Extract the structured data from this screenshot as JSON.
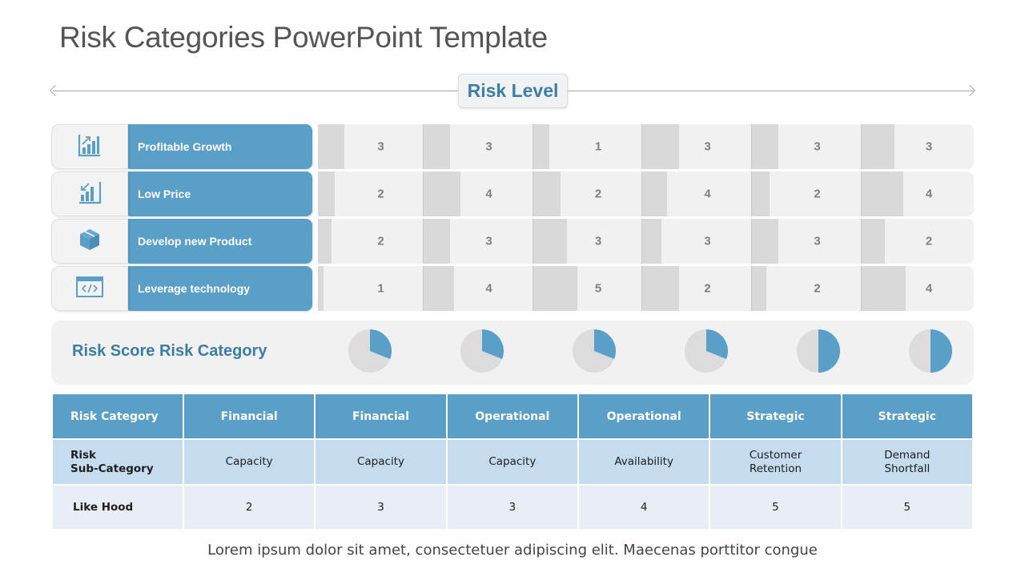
{
  "title": "Risk Categories PowerPoint Template",
  "risk_level_label": "Risk Level",
  "colors": {
    "accent": "#5a9fc8",
    "heading": "#3a7ea3",
    "bar": "#d9d9d9",
    "cell": "#f1f1f1"
  },
  "factors": [
    {
      "label": "Profitable Growth",
      "icon": "growth-chart-icon",
      "values": [
        3,
        3,
        1,
        3,
        3,
        3
      ],
      "bar_fill": [
        0.25,
        0.24,
        0.15,
        0.34,
        0.24,
        0.29
      ]
    },
    {
      "label": "Low Price",
      "icon": "declining-chart-icon",
      "values": [
        2,
        4,
        2,
        4,
        2,
        4
      ],
      "bar_fill": [
        0.16,
        0.34,
        0.25,
        0.23,
        0.16,
        0.37
      ]
    },
    {
      "label": "Develop new Product",
      "icon": "product-box-icon",
      "values": [
        2,
        3,
        3,
        3,
        3,
        2
      ],
      "bar_fill": [
        0.13,
        0.24,
        0.31,
        0.18,
        0.24,
        0.21
      ]
    },
    {
      "label": "Leverage technology",
      "icon": "code-window-icon",
      "values": [
        1,
        4,
        5,
        2,
        2,
        4
      ],
      "bar_fill": [
        0.05,
        0.28,
        0.41,
        0.34,
        0.13,
        0.39
      ]
    }
  ],
  "risk_score": {
    "title": "Risk Score Risk Category",
    "pie_fractions": [
      0.31,
      0.31,
      0.31,
      0.31,
      0.5,
      0.5
    ]
  },
  "table": {
    "row_labels": {
      "category": "Risk  Category",
      "sub_line1": "Risk",
      "sub_line2": "Sub-Category",
      "likelihood": "Like  Hood"
    },
    "columns": [
      {
        "category": "Financial",
        "sub": [
          "Capacity"
        ],
        "likelihood": "2"
      },
      {
        "category": "Financial",
        "sub": [
          "Capacity"
        ],
        "likelihood": "3"
      },
      {
        "category": "Operational",
        "sub": [
          "Capacity"
        ],
        "likelihood": "3"
      },
      {
        "category": "Operational",
        "sub": [
          "Availability"
        ],
        "likelihood": "4"
      },
      {
        "category": "Strategic",
        "sub": [
          "Customer",
          "Retention"
        ],
        "likelihood": "5"
      },
      {
        "category": "Strategic",
        "sub": [
          "Demand",
          "Shortfall"
        ],
        "likelihood": "5"
      }
    ]
  },
  "footer": "Lorem ipsum dolor sit amet, consectetuer adipiscing elit. Maecenas porttitor congue"
}
